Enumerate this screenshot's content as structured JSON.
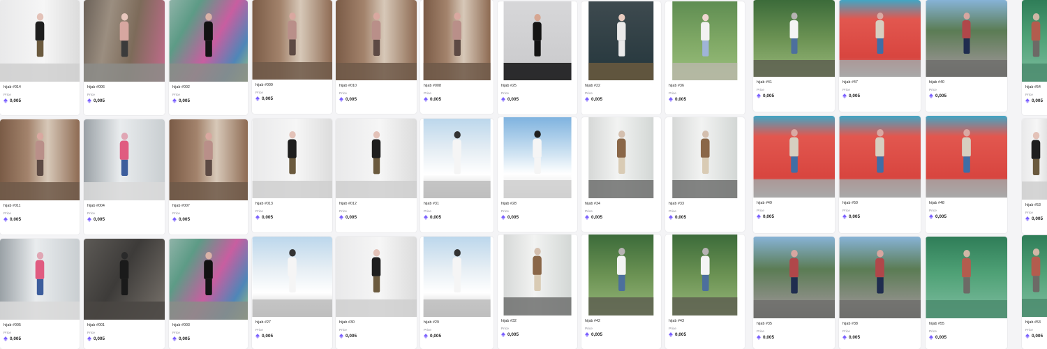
{
  "marketplace": {
    "price_label": "Price",
    "currency_icon": "ethereum-icon",
    "accent_color": "#7b61ff",
    "items": [
      {
        "name": "hijab #014",
        "price": "0,005",
        "scene": "white-wall"
      },
      {
        "name": "hijab #006",
        "price": "0,005",
        "scene": "graffiti-wood"
      },
      {
        "name": "hijab #002",
        "price": "0,005",
        "scene": "graffiti"
      },
      {
        "name": "hijab #009",
        "price": "0,005",
        "scene": "brown-door"
      },
      {
        "name": "hijab #010",
        "price": "0,005",
        "scene": "brown-door"
      },
      {
        "name": "hijab #008",
        "price": "0,005",
        "scene": "brown-door"
      },
      {
        "name": "hijab #25",
        "price": "0,005",
        "scene": "portrait"
      },
      {
        "name": "hijab #22",
        "price": "0,005",
        "scene": "dark-portrait"
      },
      {
        "name": "hijab #36",
        "price": "0,005",
        "scene": "green-path"
      },
      {
        "name": "hijab #41",
        "price": "0,005",
        "scene": "palm-bike"
      },
      {
        "name": "hijab #47",
        "price": "0,005",
        "scene": "red-truck"
      },
      {
        "name": "hijab #40",
        "price": "0,005",
        "scene": "street-trees"
      },
      {
        "name": "hijab #54",
        "price": "0,005",
        "scene": "fence-green"
      },
      {
        "name": "hijab #011",
        "price": "0,005",
        "scene": "brown-door"
      },
      {
        "name": "hijab #004",
        "price": "0,005",
        "scene": "parking-cone"
      },
      {
        "name": "hijab #007",
        "price": "0,005",
        "scene": "brown-door"
      },
      {
        "name": "hijab #013",
        "price": "0,005",
        "scene": "white-wall"
      },
      {
        "name": "hijab #012",
        "price": "0,005",
        "scene": "white-wall"
      },
      {
        "name": "hijab #31",
        "price": "0,005",
        "scene": "white-columns"
      },
      {
        "name": "hijab #28",
        "price": "0,005",
        "scene": "white-sky"
      },
      {
        "name": "hijab #34",
        "price": "0,005",
        "scene": "white-house"
      },
      {
        "name": "hijab #33",
        "price": "0,005",
        "scene": "white-house"
      },
      {
        "name": "hijab #49",
        "price": "0,005",
        "scene": "red-truck"
      },
      {
        "name": "hijab #50",
        "price": "0,005",
        "scene": "red-truck"
      },
      {
        "name": "hijab #48",
        "price": "0,005",
        "scene": "red-truck"
      },
      {
        "name": "hijab #53",
        "price": "0,005",
        "scene": "white-wall"
      },
      {
        "name": "hijab #005",
        "price": "0,005",
        "scene": "parking-cone"
      },
      {
        "name": "hijab #001",
        "price": "0,005",
        "scene": "dark-stone"
      },
      {
        "name": "hijab #003",
        "price": "0,005",
        "scene": "graffiti"
      },
      {
        "name": "hijab #27",
        "price": "0,005",
        "scene": "white-columns"
      },
      {
        "name": "hijab #30",
        "price": "0,005",
        "scene": "white-wall"
      },
      {
        "name": "hijab #29",
        "price": "0,005",
        "scene": "white-columns"
      },
      {
        "name": "hijab #32",
        "price": "0,005",
        "scene": "white-house"
      },
      {
        "name": "hijab #42",
        "price": "0,005",
        "scene": "palm-bike"
      },
      {
        "name": "hijab #43",
        "price": "0,005",
        "scene": "palm-bike"
      },
      {
        "name": "hijab #35",
        "price": "0,005",
        "scene": "street-trees"
      },
      {
        "name": "hijab #38",
        "price": "0,005",
        "scene": "street-trees"
      },
      {
        "name": "hijab #55",
        "price": "0,005",
        "scene": "fence-green"
      },
      {
        "name": "hijab #53",
        "price": "0,005",
        "scene": "fence-green"
      }
    ]
  }
}
